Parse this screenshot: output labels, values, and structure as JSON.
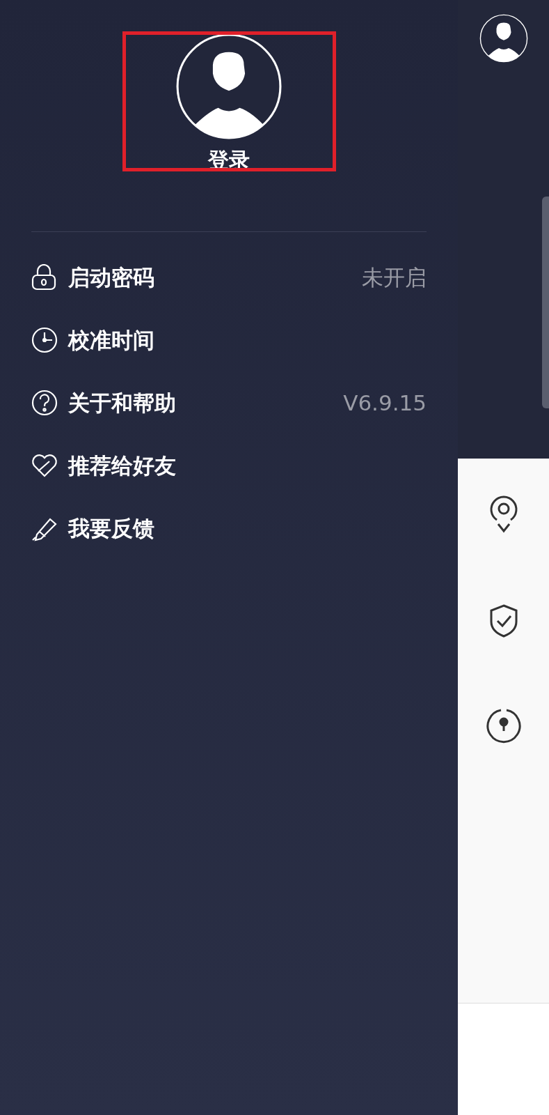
{
  "profile": {
    "login_label": "登录"
  },
  "menu": [
    {
      "label": "启动密码",
      "value": "未开启"
    },
    {
      "label": "校准时间"
    },
    {
      "label": "关于和帮助",
      "value": "V6.9.15"
    },
    {
      "label": "推荐给好友"
    },
    {
      "label": "我要反馈"
    }
  ]
}
